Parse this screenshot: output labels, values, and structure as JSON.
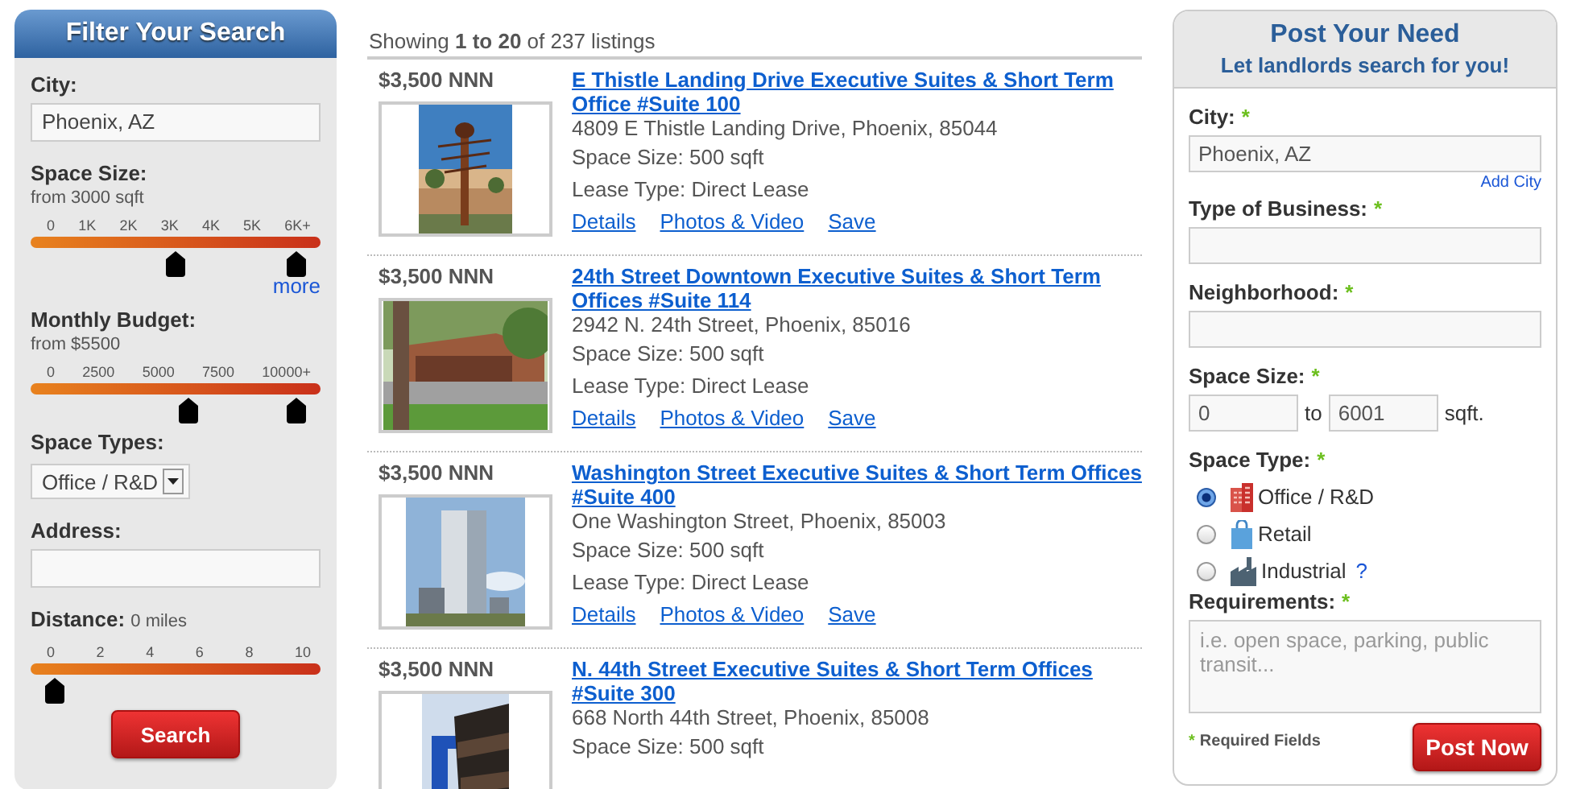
{
  "filter": {
    "title": "Filter Your Search",
    "fields": [
      {
        "kind": "text",
        "label": "City:",
        "value": "Phoenix, AZ"
      },
      {
        "kind": "range",
        "label": "Space Size:",
        "note": "from 3000 sqft",
        "inline_note": false,
        "ticks": [
          "0",
          "1K",
          "2K",
          "3K",
          "4K",
          "5K",
          "6K+"
        ],
        "handles": [
          {
            "level": 0.5
          },
          {
            "level": 1
          }
        ],
        "link": "more"
      },
      {
        "kind": "range",
        "label": "Monthly Budget:",
        "note": "from $5500",
        "inline_note": false,
        "ticks": [
          "0",
          "2500",
          "5000",
          "7500",
          "10000+"
        ],
        "handles": [
          {
            "level": 0.55
          },
          {
            "level": 1
          }
        ]
      },
      {
        "kind": "select",
        "label": "Space Types:",
        "value": "Office / R&D"
      },
      {
        "kind": "text",
        "label": "Address:"
      },
      {
        "kind": "range",
        "label": "Distance:",
        "note": "0 miles",
        "inline_note": true,
        "ticks": [
          "0",
          "2",
          "4",
          "6",
          "8",
          "10"
        ],
        "handles": [
          {
            "level": 0
          }
        ]
      }
    ],
    "button": "Search"
  },
  "results": {
    "summary": "Showing **1 to 20** of 237 listings",
    "listings": [
      {
        "price": "$3,500 NNN",
        "title": "E Thistle Landing Drive Executive Suites & Short Term Office #Suite 100",
        "address": "4809 E Thistle Landing Drive, Phoenix, 85044",
        "space_size": "Space Size: 500 sqft",
        "lease_type": "Lease Type: Direct Lease",
        "links": [
          "Details",
          "Photos & Video",
          "Save"
        ]
      },
      {
        "price": "$3,500 NNN",
        "title": "24th Street Downtown Executive Suites & Short Term Offices #Suite 114",
        "address": "2942 N. 24th Street, Phoenix, 85016",
        "space_size": "Space Size: 500 sqft",
        "lease_type": "Lease Type: Direct Lease",
        "links": [
          "Details",
          "Photos & Video",
          "Save"
        ]
      },
      {
        "price": "$3,500 NNN",
        "title": "Washington Street Executive Suites & Short Term Offices #Suite 400",
        "address": "One Washington Street, Phoenix, 85003",
        "space_size": "Space Size: 500 sqft",
        "lease_type": "Lease Type: Direct Lease",
        "links": [
          "Details",
          "Photos & Video",
          "Save"
        ]
      },
      {
        "price": "$3,500 NNN",
        "title": "N. 44th Street Executive Suites & Short Term Offices #Suite 300",
        "address": "668 North 44th Street, Phoenix, 85008",
        "space_size": "Space Size: 500 sqft"
      }
    ]
  },
  "post": {
    "title": "Post Your Need",
    "subtitle": "Let landlords search for you!",
    "city": {
      "label": "City:",
      "mark": "*",
      "value": "Phoenix, AZ",
      "link": "Add City"
    },
    "business": {
      "label": "Type of Business:",
      "mark": "*"
    },
    "neighborhood": {
      "label": "Neighborhood:",
      "mark": "*"
    },
    "size": {
      "label": "Space Size:",
      "mark": "*",
      "from": "0",
      "between": "to",
      "to": "6001",
      "unit": "sqft."
    },
    "space_type": {
      "label": "Space Type:",
      "mark": "*",
      "options": [
        {
          "kind": "office",
          "label": "Office / R&D",
          "selected": true
        },
        {
          "kind": "retail",
          "label": "Retail",
          "selected": false
        },
        {
          "kind": "industrial",
          "label": "Industrial",
          "selected": false,
          "help": "?"
        }
      ]
    },
    "requirements": {
      "label": "Requirements:",
      "mark": "*",
      "placeholder": "i.e. open space, parking, public transit..."
    },
    "note_mark": "*",
    "note": "Required Fields",
    "button": "Post Now"
  }
}
